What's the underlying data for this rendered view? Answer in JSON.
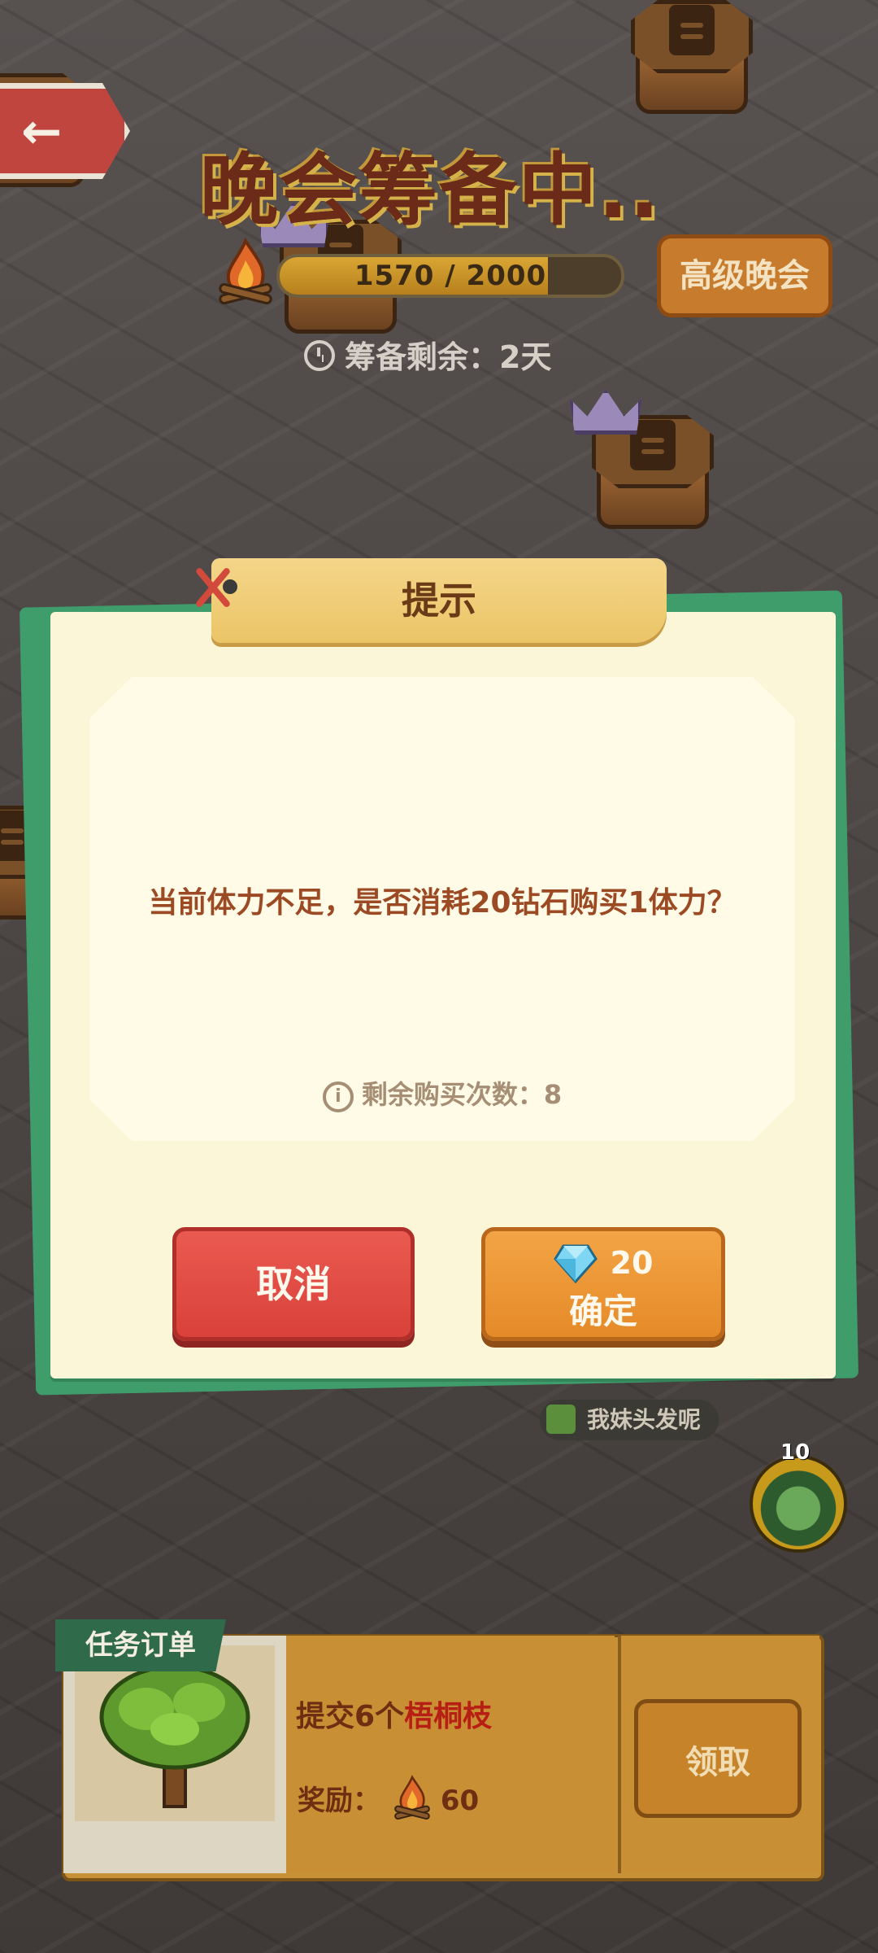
{
  "header": {
    "back_icon": "arrow-left-icon",
    "title": "晚会筹备中..",
    "progress": {
      "text": "1570 / 2000",
      "current": 1570,
      "max": 2000
    },
    "advanced_party_label": "高级晚会",
    "remaining_label": "筹备剩余：2天"
  },
  "dialog": {
    "title": "提示",
    "message": "当前体力不足，是否消耗20钻石购买1体力？",
    "remaining_buys": "剩余购买次数：8",
    "cancel_label": "取消",
    "confirm_cost": "20",
    "confirm_label": "确定",
    "confirm_icon": "diamond-icon"
  },
  "player_tag": "我妹头发呢",
  "token_count": "10",
  "task": {
    "tag": "任务订单",
    "desc_prefix": "提交6个",
    "desc_item": "梧桐枝",
    "reward_label": "奖励：",
    "reward_value": "60",
    "claim_label": "领取"
  },
  "colors": {
    "accent_green": "#3f9d6c",
    "cancel_red": "#d9413a",
    "confirm_orange": "#e58a28",
    "message_brown": "#9c4a24"
  }
}
